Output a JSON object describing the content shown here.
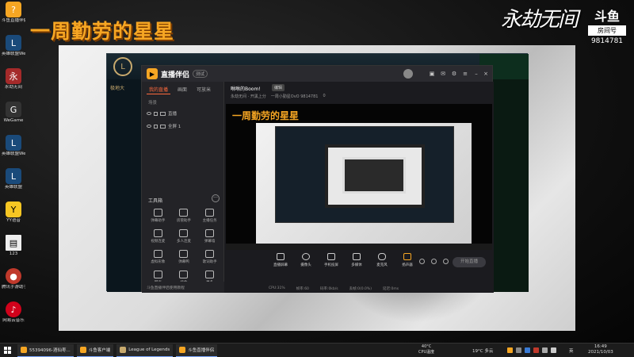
{
  "banner": {
    "title": "一周勤劳的星星",
    "game_logo": "永劫无间",
    "room_brand": "斗鱼",
    "room_label": "房间号",
    "room_number": "9814781"
  },
  "desktop_icons": [
    {
      "label": "斗鱼直播伴侣",
      "color": "#f6a623"
    },
    {
      "label": "英雄联盟WeGame版",
      "color": "#1a4a7a"
    },
    {
      "label": "永劫无间",
      "color": "#a52a2a"
    },
    {
      "label": "WeGame",
      "color": "#333333"
    },
    {
      "label": "英雄联盟WeGame版",
      "color": "#1a4a7a"
    },
    {
      "label": "英雄联盟",
      "color": "#1a4a7a"
    },
    {
      "label": "YY语音",
      "color": "#f6c623"
    },
    {
      "label": "123",
      "color": "#eeeeee"
    },
    {
      "label": "腾讯手游助手",
      "color": "#c0392b"
    },
    {
      "label": "网易云音乐",
      "color": "#d0021b"
    }
  ],
  "lol_client": {
    "nav_text": "极地大",
    "logo": "L"
  },
  "app": {
    "name": "直播伴侣",
    "version": "测试",
    "sidebar_tabs": [
      "我的直播",
      "画面",
      "可放米"
    ],
    "scene_label": "场景",
    "sources": [
      {
        "label": "直播"
      },
      {
        "label": "全屏 1"
      }
    ],
    "toolbox_title": "工具箱",
    "toolbox_more": "···",
    "tools": [
      "弹幕助手",
      "房管助手",
      "主播任务",
      "视频连麦",
      "多人连麦",
      "弹幕墙",
      "虚拟形象",
      "弹幕鸭",
      "歌词助手",
      "网页",
      "插件",
      "更多"
    ],
    "footer": "斗鱼直播伴侣使用教程",
    "room_title": "咻咻的Boom!",
    "edit_tag": "编辑",
    "sub_info": [
      "永劫无间 · 开黑上分",
      "一周小勤星OvO 9814781",
      "0"
    ],
    "preview_title": "一周勤劳的星星",
    "controls": [
      "直播屏幕",
      "摄像头",
      "手机投屏",
      "多媒体",
      "麦克风",
      "扬声器"
    ],
    "start_button": "开始直播",
    "stats": [
      "CPU:31%",
      "帧率:60",
      "码率:0kb/s",
      "丢帧:0(0.0%)",
      "延迟:0ms"
    ]
  },
  "taskbar": {
    "apps": [
      {
        "label": "55394096-酒仙枣...",
        "color": "#f6a623"
      },
      {
        "label": "斗鱼客户端",
        "color": "#f6a623"
      },
      {
        "label": "League of Legends",
        "color": "#c8aa6e"
      },
      {
        "label": "斗鱼直播伴侣",
        "color": "#f6a623"
      }
    ],
    "cpu_temp": "40°C",
    "cpu_label": "CPU温度",
    "weather": "19°C 多云",
    "ime": "英",
    "time": "16:49",
    "date": "2021/10/03"
  }
}
